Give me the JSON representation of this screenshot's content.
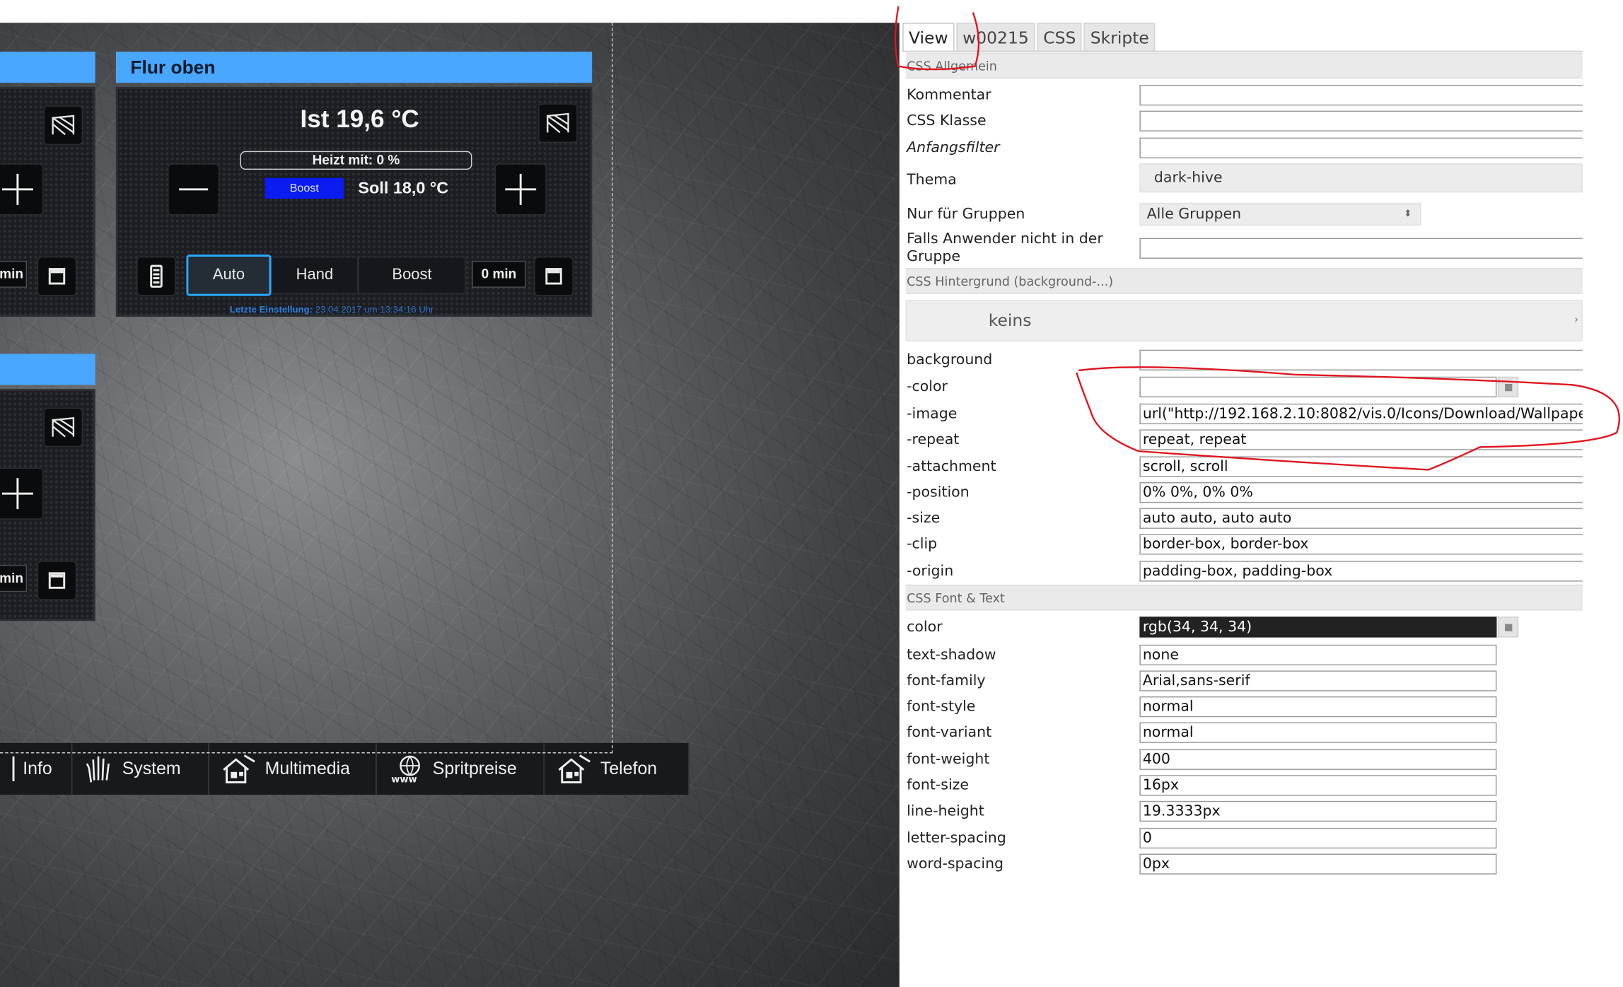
{
  "canvas": {
    "widget_left": {
      "time": "min",
      "time2": "min"
    },
    "widget_main": {
      "title": "Flur oben",
      "ist": "Ist 19,6 °C",
      "heizt": "Heizt mit: 0 %",
      "boost_badge": "Boost",
      "soll": "Soll 18,0 °C",
      "modes": [
        "Auto",
        "Hand",
        "Boost"
      ],
      "time": "0 min",
      "letzte_label": "Letzte Einstellung:",
      "letzte_value": "23.04.2017 um 13:34:16 Uhr"
    },
    "nav": [
      {
        "label": "Info",
        "icon": "info-icon"
      },
      {
        "label": "System",
        "icon": "hand-icon"
      },
      {
        "label": "Multimedia",
        "icon": "house-media-icon"
      },
      {
        "label": "Spritpreise",
        "icon": "www-icon"
      },
      {
        "label": "Telefon",
        "icon": "house-phone-icon"
      }
    ]
  },
  "panel": {
    "tabs": [
      "View",
      "w00215",
      "CSS",
      "Skripte"
    ],
    "sections": {
      "allgemein": "CSS Allgemein",
      "hintergrund": "CSS Hintergrund (background-...)",
      "font": "CSS Font & Text"
    },
    "general": {
      "kommentar": "Kommentar",
      "css_klasse": "CSS Klasse",
      "anfangsfilter": "Anfangsfilter",
      "thema": "Thema",
      "thema_value": "dark-hive",
      "gruppen": "Nur für Gruppen",
      "gruppen_value": "Alle Gruppen",
      "falls": "Falls Anwender nicht in der Gruppe"
    },
    "background": {
      "keins": "keins",
      "rows": [
        {
          "label": "background",
          "value": ""
        },
        {
          "label": "-color",
          "value": ""
        },
        {
          "label": "-image",
          "value": "url(\"http://192.168.2.10:8082/vis.0/Icons/Download/Wallpape"
        },
        {
          "label": "-repeat",
          "value": "repeat, repeat"
        },
        {
          "label": "-attachment",
          "value": "scroll, scroll"
        },
        {
          "label": "-position",
          "value": "0% 0%, 0% 0%"
        },
        {
          "label": "-size",
          "value": "auto auto, auto auto"
        },
        {
          "label": "-clip",
          "value": "border-box, border-box"
        },
        {
          "label": "-origin",
          "value": "padding-box, padding-box"
        }
      ]
    },
    "font": {
      "rows": [
        {
          "label": "color",
          "value": "rgb(34, 34, 34)"
        },
        {
          "label": "text-shadow",
          "value": "none"
        },
        {
          "label": "font-family",
          "value": "Arial,sans-serif"
        },
        {
          "label": "font-style",
          "value": "normal"
        },
        {
          "label": "font-variant",
          "value": "normal"
        },
        {
          "label": "font-weight",
          "value": "400"
        },
        {
          "label": "font-size",
          "value": "16px"
        },
        {
          "label": "line-height",
          "value": "19.3333px"
        },
        {
          "label": "letter-spacing",
          "value": "0"
        },
        {
          "label": "word-spacing",
          "value": "0px"
        }
      ]
    }
  },
  "colors": {
    "widget_header": "#4aa7ff",
    "boost_badge": "#0b1cf0",
    "annotation": "#e0141e",
    "color_field": "#222222"
  }
}
